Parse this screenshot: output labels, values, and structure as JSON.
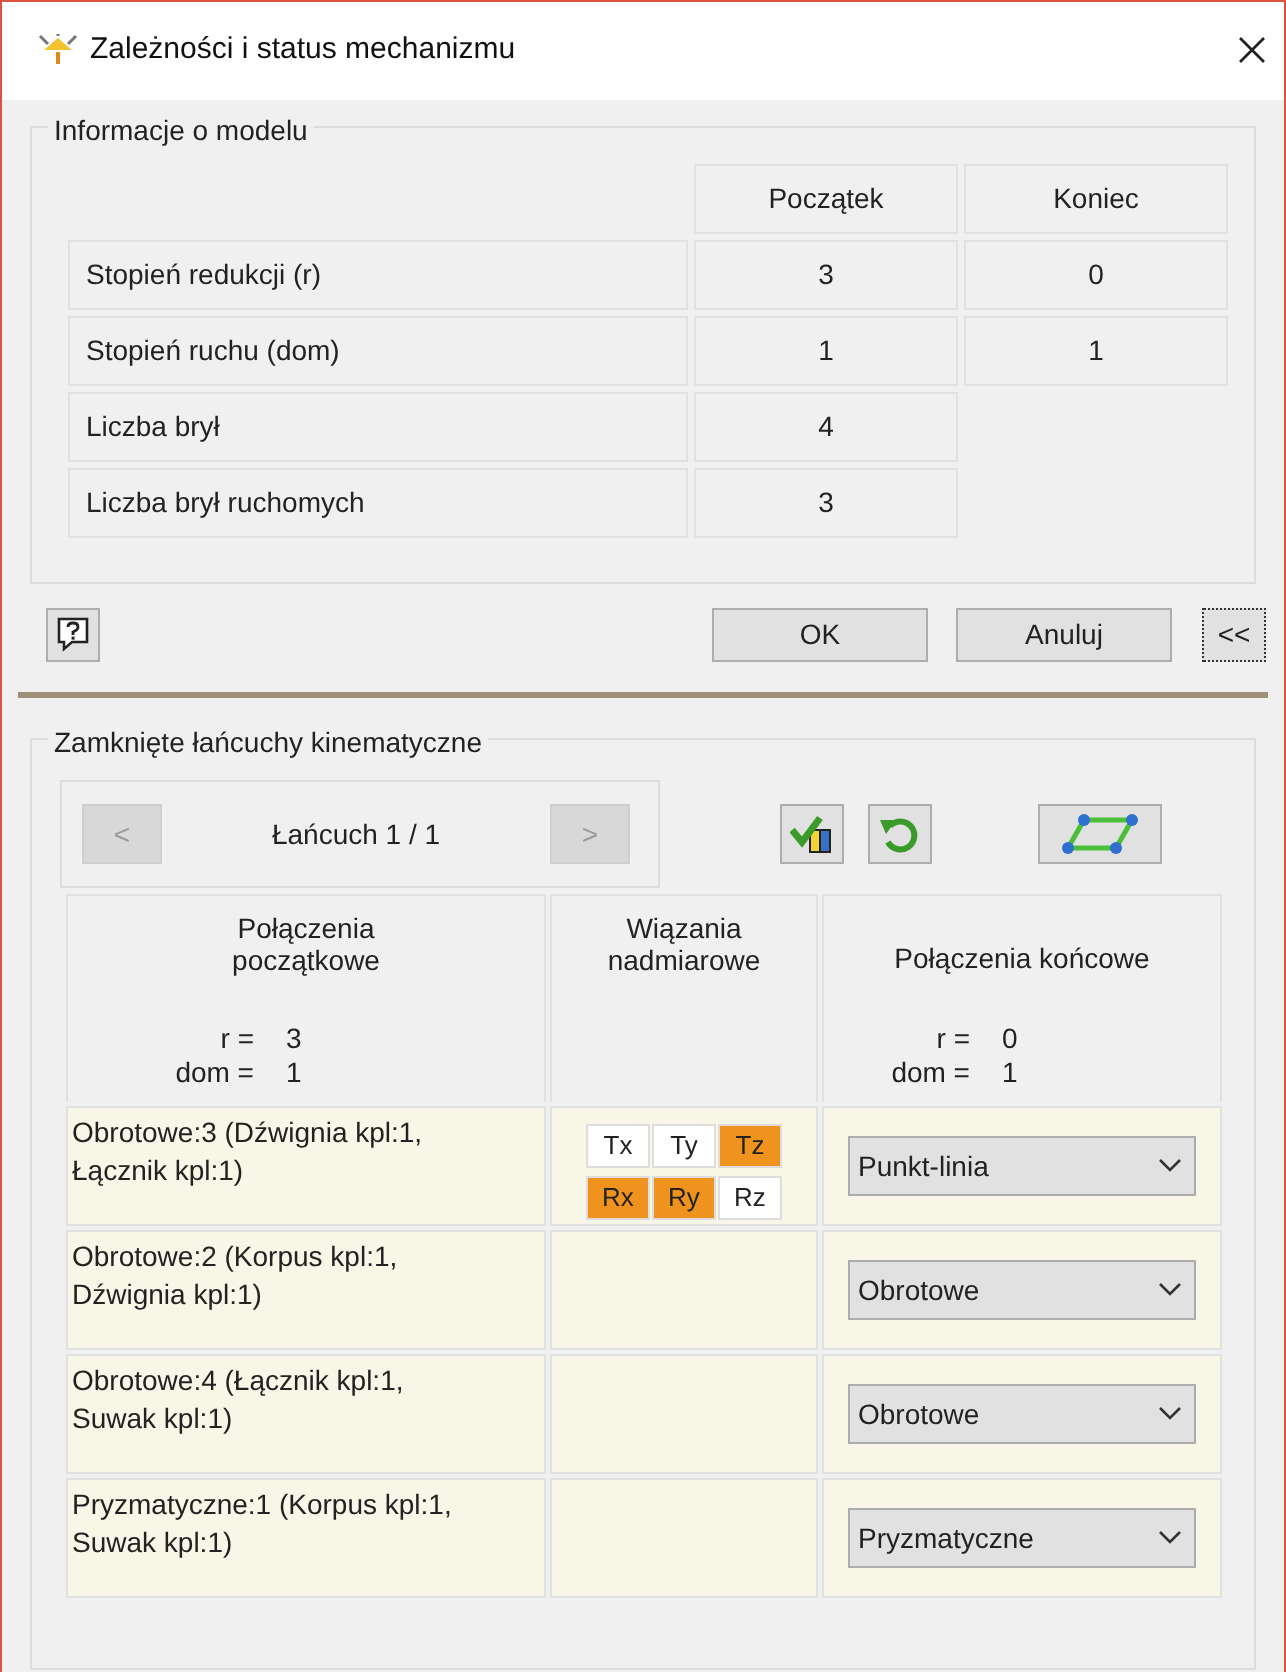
{
  "window": {
    "title": "Zależności i status mechanizmu"
  },
  "model_info": {
    "title": "Informacje o modelu",
    "columns": [
      "Początek",
      "Koniec"
    ],
    "rows": [
      {
        "label": "Stopień redukcji (r)",
        "start": "3",
        "end": "0"
      },
      {
        "label": "Stopień ruchu (dom)",
        "start": "1",
        "end": "1"
      },
      {
        "label": "Liczba brył",
        "start": "4"
      },
      {
        "label": "Liczba brył ruchomych",
        "start": "3"
      }
    ]
  },
  "buttons": {
    "ok": "OK",
    "cancel": "Anuluj",
    "collapse": "<<"
  },
  "chains": {
    "title": "Zamknięte łańcuchy kinematyczne",
    "navigator": {
      "prev": "<",
      "label": "Łańcuch 1 / 1",
      "next": ">",
      "prev_disabled": true,
      "next_disabled": true
    },
    "columns": [
      "Połączenia początkowe",
      "Wiązania nadmiarowe",
      "Połączenia końcowe"
    ],
    "start_summary": {
      "r_label": "r =",
      "r": "3",
      "dom_label": "dom =",
      "dom": "1"
    },
    "end_summary": {
      "r_label": "r =",
      "r": "0",
      "dom_label": "dom =",
      "dom": "1"
    },
    "rows": [
      {
        "joint": "Obrotowe:3 (Dźwignia kpl:1, Łącznik kpl:1)",
        "redundant": [
          {
            "label": "Tx",
            "on": false
          },
          {
            "label": "Ty",
            "on": false
          },
          {
            "label": "Tz",
            "on": true
          },
          {
            "label": "Rx",
            "on": true
          },
          {
            "label": "Ry",
            "on": true
          },
          {
            "label": "Rz",
            "on": false
          }
        ],
        "end_type": "Punkt-linia"
      },
      {
        "joint": "Obrotowe:2 (Korpus kpl:1, Dźwignia  kpl:1)",
        "end_type": "Obrotowe"
      },
      {
        "joint": "Obrotowe:4 (Łącznik kpl:1, Suwak kpl:1)",
        "end_type": "Obrotowe"
      },
      {
        "joint": "Pryzmatyczne:1 (Korpus kpl:1, Suwak kpl:1)",
        "end_type": "Pryzmatyczne"
      }
    ]
  }
}
